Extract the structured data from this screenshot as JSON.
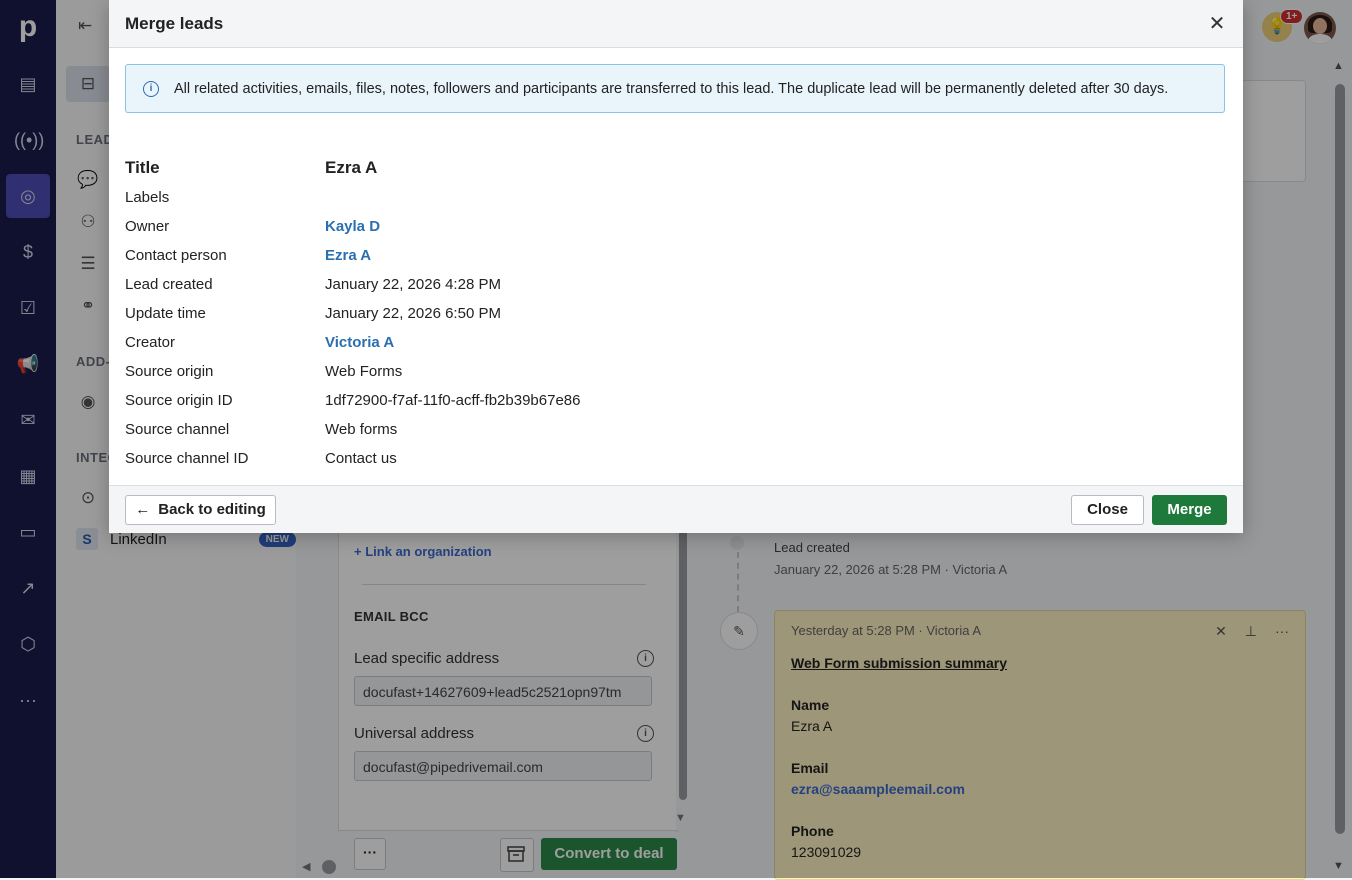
{
  "background": {
    "sidebar": {
      "section_leads": "LEAD",
      "section_addons": "ADD-",
      "section_integrations": "INTEG",
      "linkedin_label": "LinkedIn",
      "linkedin_badge": "NEW",
      "linkedin_icon_letter": "S"
    },
    "panel": {
      "link_org": "+ Link an organization",
      "email_bcc": "EMAIL BCC",
      "lead_specific_label": "Lead specific address",
      "lead_specific_value": "docufast+14627609+lead5c2521opn97tm",
      "universal_label": "Universal address",
      "universal_value": "docufast@pipedrivemail.com",
      "more_label": "···",
      "convert_label": "Convert to deal"
    },
    "feed": {
      "lead_created": "Lead created",
      "lead_created_meta": "January 22, 2026 at 5:28 PM · Victoria A",
      "note_meta": "Yesterday at 5:28 PM · Victoria A",
      "note_title": "Web Form submission summary",
      "name_key": "Name",
      "name_val": "Ezra A",
      "email_key": "Email",
      "email_val": "ezra@saaampleemail.com",
      "phone_key": "Phone",
      "phone_val": "123091029"
    },
    "header": {
      "badge": "1+"
    }
  },
  "modal": {
    "title": "Merge leads",
    "banner": "All related activities, emails, files, notes, followers and participants are transferred to this lead. The duplicate lead will be permanently deleted after 30 days.",
    "fields": [
      {
        "key": "Title",
        "value": "Ezra A",
        "link": false
      },
      {
        "key": "Labels",
        "value": "",
        "link": false
      },
      {
        "key": "Owner",
        "value": "Kayla D",
        "link": true
      },
      {
        "key": "Contact person",
        "value": "Ezra A",
        "link": true
      },
      {
        "key": "Lead created",
        "value": "January 22, 2026 4:28 PM",
        "link": false
      },
      {
        "key": "Update time",
        "value": "January 22, 2026 6:50 PM",
        "link": false
      },
      {
        "key": "Creator",
        "value": "Victoria A",
        "link": true
      },
      {
        "key": "Source origin",
        "value": "Web Forms",
        "link": false
      },
      {
        "key": "Source origin ID",
        "value": "1df72900-f7af-11f0-acff-fb2b39b67e86",
        "link": false
      },
      {
        "key": "Source channel",
        "value": "Web forms",
        "link": false
      },
      {
        "key": "Source channel ID",
        "value": "Contact us",
        "link": false
      }
    ],
    "back_label": "Back to editing",
    "close_label": "Close",
    "merge_label": "Merge"
  },
  "colors": {
    "rail": "#1b1b4d",
    "accent": "#2a6fb2",
    "merge": "#1e7a3a"
  }
}
